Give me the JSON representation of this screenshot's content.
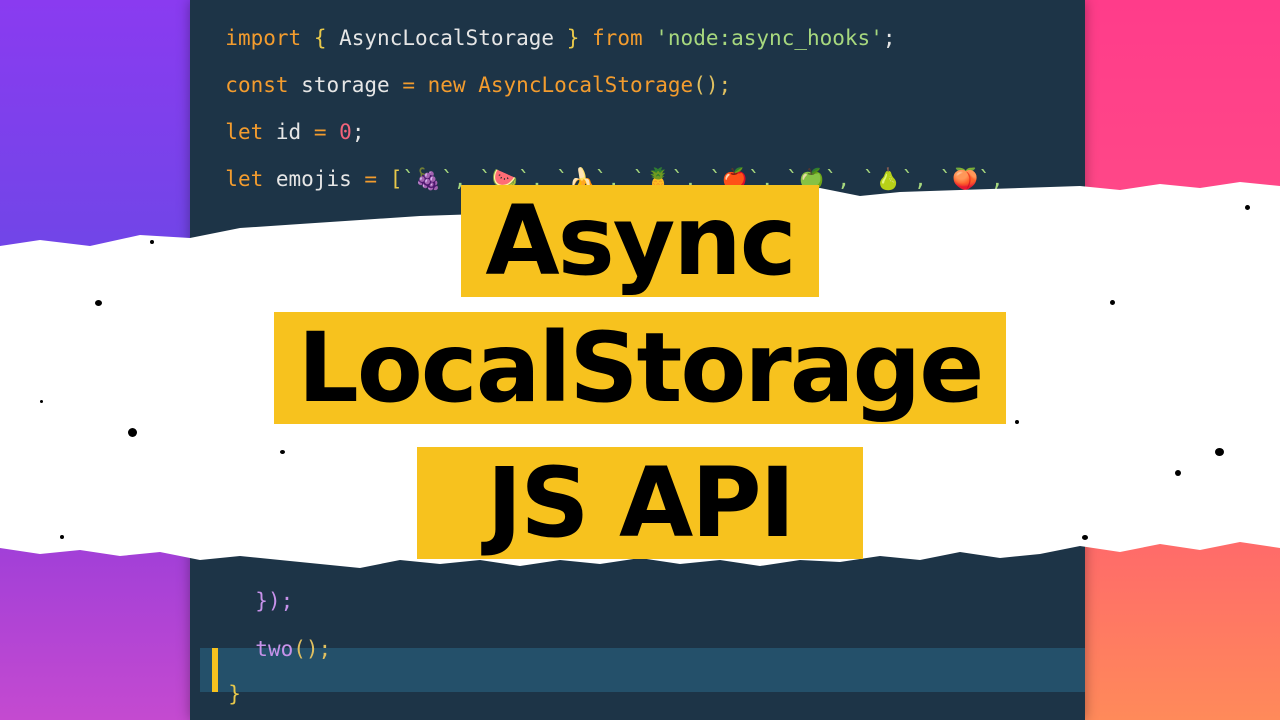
{
  "code": {
    "line1": {
      "kw1": "import",
      "open": "{",
      "name": "AsyncLocalStorage",
      "close": "}",
      "kw2": "from",
      "module": "'node:async_hooks'",
      "end": ";"
    },
    "line2": {
      "kw1": "const",
      "var": "storage",
      "eq": "=",
      "kw2": "new",
      "cls": "AsyncLocalStorage",
      "call": "();"
    },
    "line3": {
      "kw1": "let",
      "var": "id",
      "eq": "=",
      "num": "0",
      "end": ";"
    },
    "line4": {
      "kw1": "let",
      "var": "emojis",
      "eq": "=",
      "bracket": "[",
      "items": "`🍇`, `🍉`, `🍌`, `🍍`, `🍎`, `🍏`, `🍐`, `🍑`,"
    },
    "line5": {
      "text": "});"
    },
    "line6": {
      "fn": "two",
      "call": "();"
    },
    "line7": {
      "brace": "}"
    }
  },
  "title": {
    "line1": "Async",
    "line2": "LocalStorage",
    "line3": "JS API"
  },
  "colors": {
    "highlight": "#f7c21e",
    "editor_bg": "#1d3447",
    "left_gradient_top": "#8a3bf0",
    "right_gradient_top": "#ff3c8a"
  }
}
